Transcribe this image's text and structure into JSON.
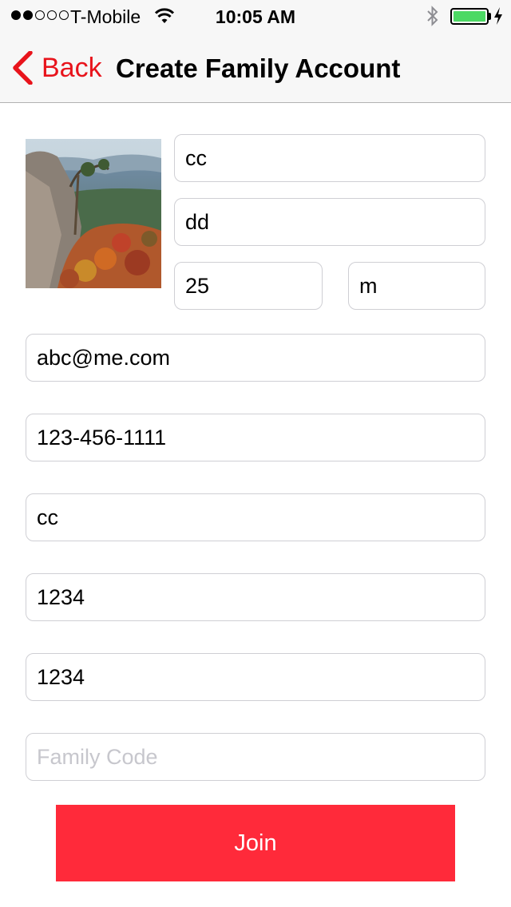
{
  "status_bar": {
    "carrier": "T-Mobile",
    "time": "10:05 AM",
    "signal_bars_filled": 2,
    "signal_bars_total": 5,
    "battery_level": 1.0,
    "battery_color": "#4cd964"
  },
  "nav": {
    "back_label": "Back",
    "title": "Create Family Account",
    "accent_color": "#e8141c"
  },
  "form": {
    "first_name": "cc",
    "last_name": "dd",
    "age": "25",
    "gender": "m",
    "email": "abc@me.com",
    "phone": "123-456-1111",
    "username": "cc",
    "password": "1234",
    "confirm_password": "1234",
    "family_code": "",
    "family_code_placeholder": "Family Code"
  },
  "join_button": {
    "label": "Join",
    "color": "#ff2a3a"
  }
}
